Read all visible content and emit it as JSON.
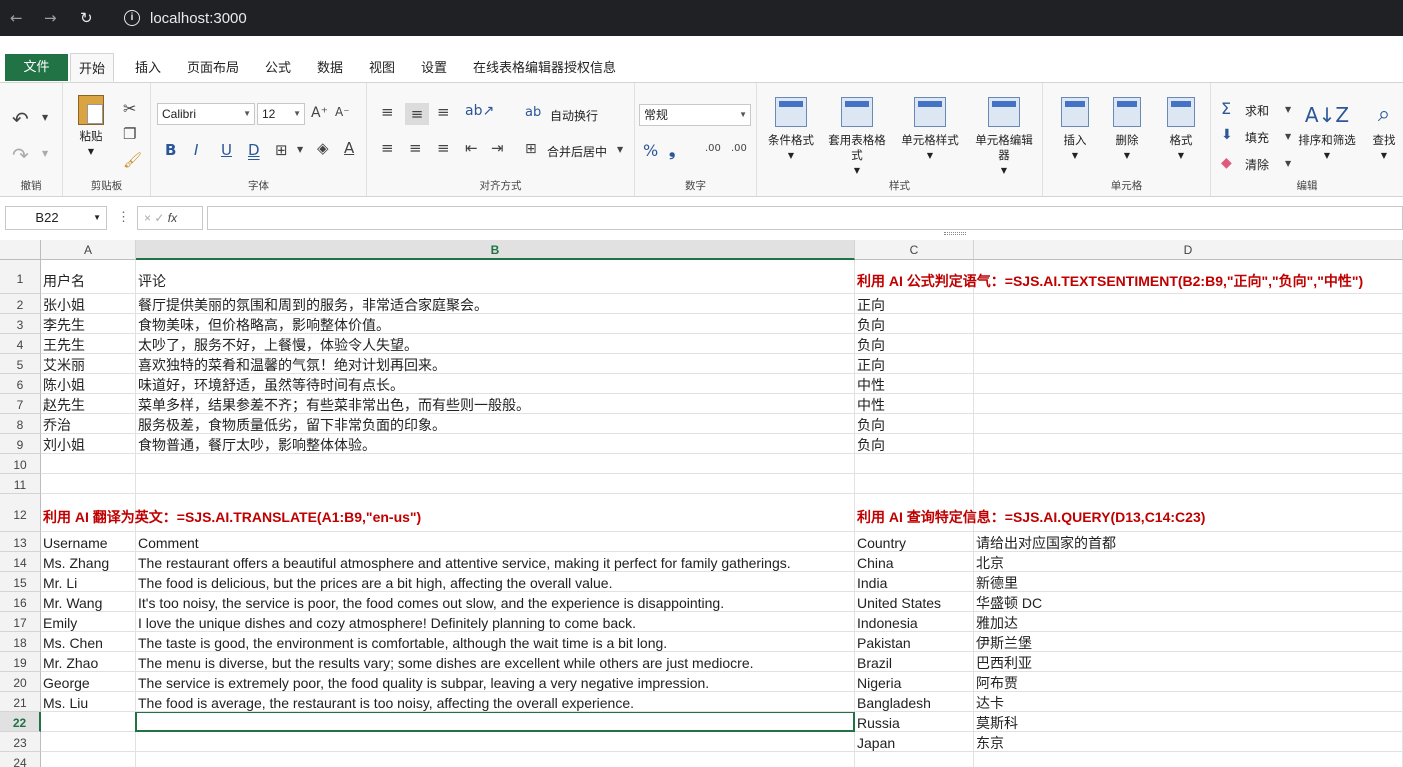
{
  "browser": {
    "url": "localhost:3000"
  },
  "tabs": [
    "文件",
    "开始",
    "插入",
    "页面布局",
    "公式",
    "数据",
    "视图",
    "设置",
    "在线表格编辑器授权信息"
  ],
  "ribbon": {
    "groups": {
      "undo": "撤销",
      "clipboard": "剪贴板",
      "font": "字体",
      "align": "对齐方式",
      "number": "数字",
      "styles": "样式",
      "cells": "单元格",
      "edit": "编辑"
    },
    "paste": "粘贴",
    "font_name": "Calibri",
    "font_size": "12",
    "wrap": "自动换行",
    "merge": "合并后居中",
    "number_format": "常规",
    "cond_format": "条件格式",
    "table_format": "套用表格格式",
    "cell_style": "单元格样式",
    "cell_editor": "单元格编辑器",
    "insert": "插入",
    "delete": "删除",
    "format": "格式",
    "sum": "求和",
    "fill": "填充",
    "clear": "清除",
    "sort": "排序和筛选",
    "find": "查找"
  },
  "formula_bar": {
    "name_box": "B22",
    "fx": "fx",
    "value": ""
  },
  "columns": [
    "A",
    "B",
    "C",
    "D"
  ],
  "rows": [
    "1",
    "2",
    "3",
    "4",
    "5",
    "6",
    "7",
    "8",
    "9",
    "10",
    "11",
    "12",
    "13",
    "14",
    "15",
    "16",
    "17",
    "18",
    "19",
    "20",
    "21",
    "22",
    "23",
    "24"
  ],
  "cells": {
    "A1": "用户名",
    "B1": "评论",
    "C1": "利用 AI 公式判定语气：=SJS.AI.TEXTSENTIMENT(B2:B9,\"正向\",\"负向\",\"中性\")",
    "A2": "张小姐",
    "B2": "餐厅提供美丽的氛围和周到的服务，非常适合家庭聚会。",
    "C2": "正向",
    "A3": "李先生",
    "B3": "食物美味，但价格略高，影响整体价值。",
    "C3": "负向",
    "A4": "王先生",
    "B4": "太吵了，服务不好，上餐慢，体验令人失望。",
    "C4": "负向",
    "A5": "艾米丽",
    "B5": "喜欢独特的菜肴和温馨的气氛！绝对计划再回来。",
    "C5": "正向",
    "A6": "陈小姐",
    "B6": "味道好，环境舒适，虽然等待时间有点长。",
    "C6": "中性",
    "A7": "赵先生",
    "B7": "菜单多样，结果参差不齐；有些菜非常出色，而有些则一般般。",
    "C7": "中性",
    "A8": "乔治",
    "B8": "服务极差，食物质量低劣，留下非常负面的印象。",
    "C8": "负向",
    "A9": "刘小姐",
    "B9": "食物普通，餐厅太吵，影响整体体验。",
    "C9": "负向",
    "A12": "利用 AI 翻译为英文：=SJS.AI.TRANSLATE(A1:B9,\"en-us\")",
    "C12": "利用 AI 查询特定信息：=SJS.AI.QUERY(D13,C14:C23)",
    "A13": "Username",
    "B13": "Comment",
    "C13": "Country",
    "D13": "请给出对应国家的首都",
    "A14": "Ms. Zhang",
    "B14": "The restaurant offers a beautiful atmosphere and attentive service, making it perfect for family gatherings.",
    "C14": "China",
    "D14": "北京",
    "A15": "Mr. Li",
    "B15": "The food is delicious, but the prices are a bit high, affecting the overall value.",
    "C15": "India",
    "D15": "新德里",
    "A16": "Mr. Wang",
    "B16": "It's too noisy, the service is poor, the food comes out slow, and the experience is disappointing.",
    "C16": "United States",
    "D16": "华盛顿 DC",
    "A17": "Emily",
    "B17": "I love the unique dishes and cozy atmosphere! Definitely planning to come back.",
    "C17": "Indonesia",
    "D17": "雅加达",
    "A18": "Ms. Chen",
    "B18": "The taste is good, the environment is comfortable, although the wait time is a bit long.",
    "C18": "Pakistan",
    "D18": "伊斯兰堡",
    "A19": "Mr. Zhao",
    "B19": "The menu is diverse, but the results vary; some dishes are excellent while others are just mediocre.",
    "C19": "Brazil",
    "D19": "巴西利亚",
    "A20": "George",
    "B20": "The service is extremely poor, the food quality is subpar, leaving a very negative impression.",
    "C20": "Nigeria",
    "D20": "阿布贾",
    "A21": "Ms. Liu",
    "B21": "The food is average, the restaurant is too noisy, affecting the overall experience.",
    "C21": "Bangladesh",
    "D21": "达卡",
    "C22": "Russia",
    "D22": "莫斯科",
    "C23": "Japan",
    "D23": "东京"
  }
}
